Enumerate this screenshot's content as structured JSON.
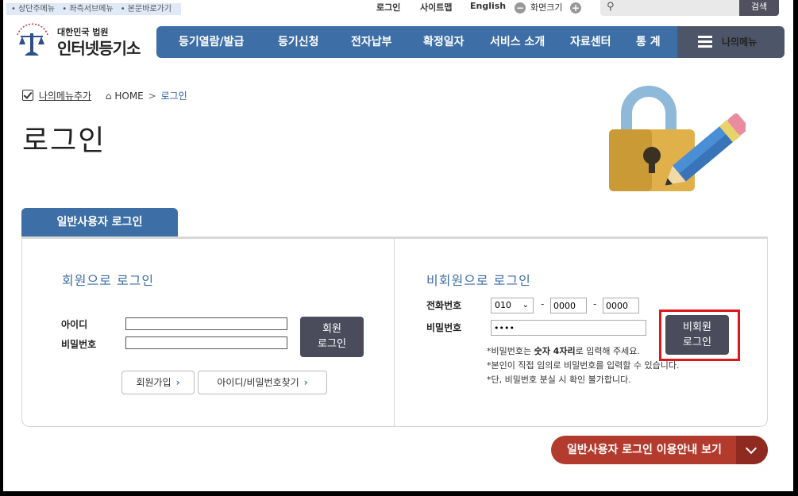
{
  "skip_nav": [
    "• 상단주메뉴",
    "• 좌측서브메뉴",
    "• 본문바로가기"
  ],
  "util": {
    "login": "로그인",
    "sitemap": "사이트맵",
    "english": "English",
    "zoom_label": "화면크기",
    "zoom_out": "−",
    "zoom_in": "+",
    "search_button": "검색",
    "search_placeholder": ""
  },
  "logo": {
    "line1": "대한민국 법원",
    "line2": "인터넷등기소"
  },
  "gnb": [
    "등기열람/발급",
    "등기신청",
    "전자납부",
    "확정일자",
    "서비스 소개",
    "자료센터",
    "통 계"
  ],
  "my_menu": "나의메뉴",
  "breadcrumb": {
    "add_favorite": "나의메뉴추가",
    "home": "HOME",
    "separator": ">",
    "current": "로그인"
  },
  "page_title": "로그인",
  "tab": "일반사용자 로그인",
  "member": {
    "title": "회원으로 로그인",
    "id_label": "아이디",
    "pw_label": "비밀번호",
    "id_value": "",
    "pw_value": "",
    "login_button_line1": "회원",
    "login_button_line2": "로그인",
    "signup_button": "회원가입",
    "find_button": "아이디/비밀번호찾기"
  },
  "nonmember": {
    "title": "비회원으로 로그인",
    "phone_label": "전화번호",
    "pw_label": "비밀번호",
    "phone_prefix": "010",
    "phone_mid": "0000",
    "phone_last": "0000",
    "pw_value": "••••",
    "login_button_line1": "비회원",
    "login_button_line2": "로그인",
    "notes": [
      {
        "prefix": "*비밀번호는 ",
        "bold": "숫자 4자리",
        "suffix": "로 입력해 주세요."
      },
      {
        "prefix": "*본인이 직접 임의로 비밀번호를 입력할 수 있습니다.",
        "bold": "",
        "suffix": ""
      },
      {
        "prefix": "*단, 비밀번호 분실 시 확인 불가합니다.",
        "bold": "",
        "suffix": ""
      }
    ]
  },
  "guide_button": "일반사용자 로그인 이용안내 보기",
  "colors": {
    "primary": "#3d6ea6",
    "dark": "#4a4c5c",
    "guide": "#b33b2d",
    "highlight": "#e0161e"
  }
}
